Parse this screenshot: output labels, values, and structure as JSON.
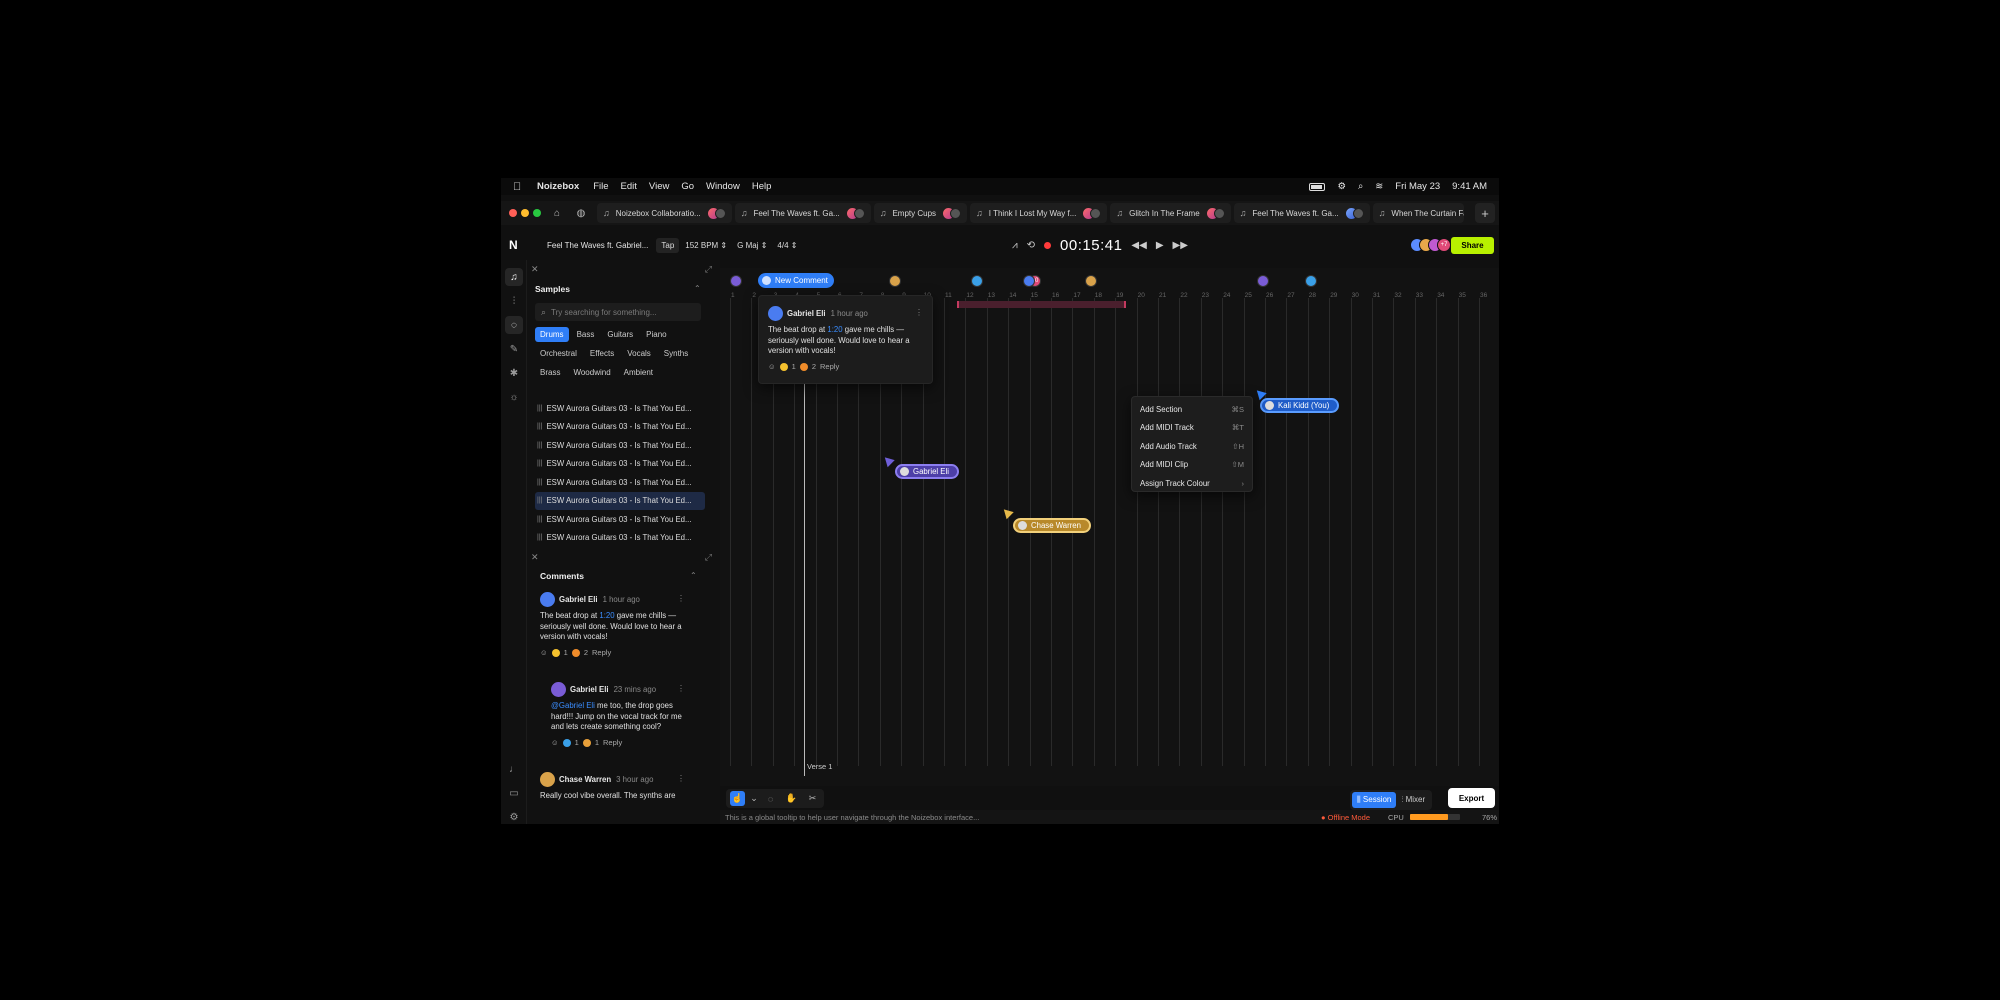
{
  "menubar": {
    "app_name": "Noizebox",
    "menus": [
      "File",
      "Edit",
      "View",
      "Go",
      "Window",
      "Help"
    ],
    "date": "Fri May 23",
    "time": "9:41 AM"
  },
  "tabs": [
    {
      "label": "Noizebox Collaboratio..."
    },
    {
      "label": "Feel The Waves ft. Ga..."
    },
    {
      "label": "Empty Cups"
    },
    {
      "label": "I Think I Lost My Way f..."
    },
    {
      "label": "Glitch In The Frame"
    },
    {
      "label": "Feel The Waves ft. Ga..."
    },
    {
      "label": "When The Curtain Fa"
    }
  ],
  "toolbar": {
    "song": "Feel The Waves ft. Gabriel...",
    "tap": "Tap",
    "bpm": "152 BPM",
    "key": "G Maj",
    "time_sig": "4/4",
    "timer": "00:15:41",
    "avatar_count": "+7",
    "share": "Share"
  },
  "samples": {
    "title": "Samples",
    "search_placeholder": "Try searching for something...",
    "categories_row1": [
      "Drums",
      "Bass",
      "Guitars",
      "Piano"
    ],
    "categories_row2": [
      "Orchestral",
      "Effects",
      "Vocals",
      "Synths"
    ],
    "categories_row3": [
      "Brass",
      "Woodwind",
      "Ambient"
    ],
    "active_category": "Drums",
    "items": [
      "ESW Aurora Guitars 03 - Is That You Ed...",
      "ESW Aurora Guitars 03 - Is That You Ed...",
      "ESW Aurora Guitars 03 - Is That You Ed...",
      "ESW Aurora Guitars 03 - Is That You Ed...",
      "ESW Aurora Guitars 03 - Is That You Ed...",
      "ESW Aurora Guitars 03 - Is That You Ed...",
      "ESW Aurora Guitars 03 - Is That You Ed...",
      "ESW Aurora Guitars 03 - Is That You Ed..."
    ],
    "active_index": 5
  },
  "comments": {
    "title": "Comments",
    "items": [
      {
        "author": "Gabriel Eli",
        "time": "1 hour ago",
        "text_before": "The beat drop at ",
        "link": "1:20",
        "text_after": " gave me chills — seriously well done. Would love to hear a version with vocals!",
        "reaction1": "1",
        "reaction2": "2",
        "reply": "Reply"
      },
      {
        "author": "Gabriel Eli",
        "time": "23 mins ago",
        "mention": "@Gabriel Eli",
        "text": " me too, the drop goes hard!!! Jump on the vocal track for me and lets create something cool?",
        "reaction1": "1",
        "reaction2": "1",
        "reply": "Reply"
      },
      {
        "author": "Chase Warren",
        "time": "3 hour ago",
        "text": "Really cool vibe overall. The synths are"
      }
    ]
  },
  "timeline": {
    "bars": [
      "1",
      "2",
      "3",
      "4",
      "5",
      "6",
      "7",
      "8",
      "9",
      "10",
      "11",
      "12",
      "13",
      "14",
      "15",
      "16",
      "17",
      "18",
      "19",
      "20",
      "21",
      "22",
      "23",
      "24",
      "25",
      "26",
      "27",
      "28",
      "29",
      "30",
      "31",
      "32",
      "33",
      "34",
      "35",
      "36",
      "37"
    ],
    "new_comment": "New Comment",
    "marker_badge": "10",
    "section_label": "Verse 1",
    "popover": {
      "author": "Gabriel Eli",
      "time": "1 hour ago",
      "text_before": "The beat drop at ",
      "link": "1:20",
      "text_after": " gave me chills — seriously well done. Would love to hear a version with vocals!",
      "reaction1": "1",
      "reaction2": "2",
      "reply": "Reply"
    },
    "cursors": [
      {
        "name": "Gabriel Eli",
        "color": "#6f5fd8"
      },
      {
        "name": "Chase Warren",
        "color": "#e6b94a"
      },
      {
        "name": "Kali Kidd (You)",
        "color": "#2f7ef7"
      }
    ],
    "context_menu": [
      {
        "label": "Add Section",
        "shortcut": "⌘S"
      },
      {
        "label": "Add MIDI Track",
        "shortcut": "⌘T"
      },
      {
        "label": "Add Audio Track",
        "shortcut": "⇧H"
      },
      {
        "label": "Add MIDI Clip",
        "shortcut": "⇧M"
      },
      {
        "label": "Assign Track Colour",
        "shortcut": "›"
      }
    ]
  },
  "bottom": {
    "session": "Session",
    "mixer": "Mixer",
    "export": "Export"
  },
  "status": {
    "tooltip": "This is a global tooltip to help user navigate through the Noizebox interface...",
    "offline": "Offline Mode",
    "cpu_label": "CPU",
    "cpu_percent": "76%",
    "cpu_value": 0.76
  }
}
